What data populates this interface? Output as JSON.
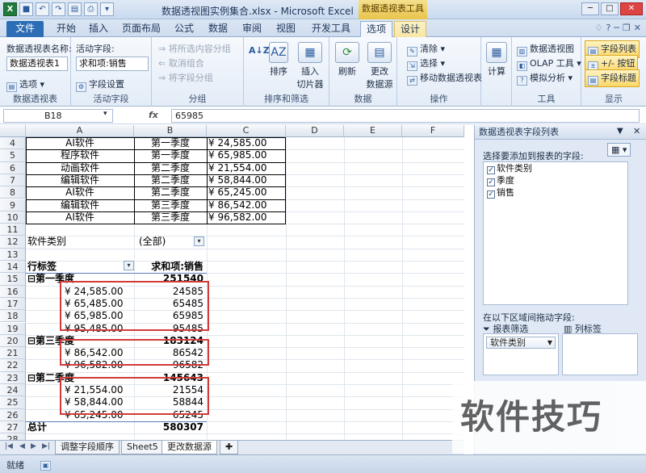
{
  "window": {
    "title": "数据透视图实例集合.xlsx - Microsoft Excel",
    "context_tab_title": "数据透视表工具",
    "buttons": [
      "─",
      "□",
      "✕"
    ]
  },
  "tabs": [
    "文件",
    "开始",
    "插入",
    "页面布局",
    "公式",
    "数据",
    "审阅",
    "视图",
    "开发工具",
    "选项",
    "设计"
  ],
  "ribbon": {
    "pivot_name_label": "数据透视表名称:",
    "pivot_name_value": "数据透视表1",
    "options_label": "选项",
    "group_pivot": "数据透视表",
    "active_field_label": "活动字段:",
    "active_field_value": "求和项:销售",
    "field_settings": "字段设置",
    "group_active_field": "活动字段",
    "expand_selected": "将所选内容分组",
    "ungroup": "取消组合",
    "group_field": "将字段分组",
    "group_group": "分组",
    "sort_label": "排序",
    "insert_slicer": "插入\n切片器",
    "group_sort": "排序和筛选",
    "refresh": "刷新",
    "change_source": "更改\n数据源",
    "group_data": "数据",
    "clear": "清除",
    "select": "选择",
    "move_pivot": "移动数据透视表",
    "group_actions": "操作",
    "calculate": "计算",
    "pivot_chart": "数据透视图",
    "olap_tools": "OLAP 工具",
    "what_if": "模拟分析",
    "group_tools": "工具",
    "field_list": "字段列表",
    "plus_minus": "+/- 按钮",
    "field_headers": "字段标题",
    "group_show": "显示"
  },
  "formula_bar": {
    "name_box": "B18",
    "fx": "fx",
    "value": "65985"
  },
  "columns": [
    "A",
    "B",
    "C",
    "D",
    "E",
    "F"
  ],
  "rows": [
    {
      "n": "4",
      "a": "AI软件",
      "b": "第一季度",
      "c": "¥   24,585.00"
    },
    {
      "n": "5",
      "a": "程序软件",
      "b": "第一季度",
      "c": "¥   65,985.00"
    },
    {
      "n": "6",
      "a": "动画软件",
      "b": "第二季度",
      "c": "¥   21,554.00"
    },
    {
      "n": "7",
      "a": "编辑软件",
      "b": "第二季度",
      "c": "¥   58,844.00"
    },
    {
      "n": "8",
      "a": "AI软件",
      "b": "第二季度",
      "c": "¥   65,245.00"
    },
    {
      "n": "9",
      "a": "编辑软件",
      "b": "第三季度",
      "c": "¥   86,542.00"
    },
    {
      "n": "10",
      "a": "AI软件",
      "b": "第三季度",
      "c": "¥   96,582.00"
    },
    {
      "n": "11",
      "a": "",
      "b": "",
      "c": ""
    },
    {
      "n": "12",
      "a": "软件类别",
      "b": "(全部)",
      "c": ""
    },
    {
      "n": "13",
      "a": "",
      "b": "",
      "c": ""
    },
    {
      "n": "14",
      "a": "行标签",
      "b": "求和项:销售",
      "c": ""
    },
    {
      "n": "15",
      "a": "⊟第一季度",
      "b": "251540",
      "c": ""
    },
    {
      "n": "16",
      "a": "¥   24,585.00",
      "b": "24585",
      "c": ""
    },
    {
      "n": "17",
      "a": "¥   65,485.00",
      "b": "65485",
      "c": ""
    },
    {
      "n": "18",
      "a": "¥   65,985.00",
      "b": "65985",
      "c": ""
    },
    {
      "n": "19",
      "a": "¥   95,485.00",
      "b": "95485",
      "c": ""
    },
    {
      "n": "20",
      "a": "⊟第三季度",
      "b": "183124",
      "c": ""
    },
    {
      "n": "21",
      "a": "¥   86,542.00",
      "b": "86542",
      "c": ""
    },
    {
      "n": "22",
      "a": "¥   96,582.00",
      "b": "96582",
      "c": ""
    },
    {
      "n": "23",
      "a": "⊟第二季度",
      "b": "145643",
      "c": ""
    },
    {
      "n": "24",
      "a": "¥   21,554.00",
      "b": "21554",
      "c": ""
    },
    {
      "n": "25",
      "a": "¥   58,844.00",
      "b": "58844",
      "c": ""
    },
    {
      "n": "26",
      "a": "¥   65,245.00",
      "b": "65245",
      "c": ""
    },
    {
      "n": "27",
      "a": "总计",
      "b": "580307",
      "c": ""
    },
    {
      "n": "28",
      "a": "",
      "b": "",
      "c": ""
    }
  ],
  "sheet_tabs": [
    "调整字段顺序",
    "Sheet5",
    "更改数据源"
  ],
  "status": "就绪",
  "pane": {
    "title": "数据透视表字段列表",
    "prompt": "选择要添加到报表的字段:",
    "fields": [
      "软件类别",
      "季度",
      "销售"
    ],
    "drag_prompt": "在以下区域间拖动字段:",
    "report_filter": "报表筛选",
    "column_labels": "列标签",
    "filter_item": "软件类别"
  },
  "watermark": "软件技巧"
}
